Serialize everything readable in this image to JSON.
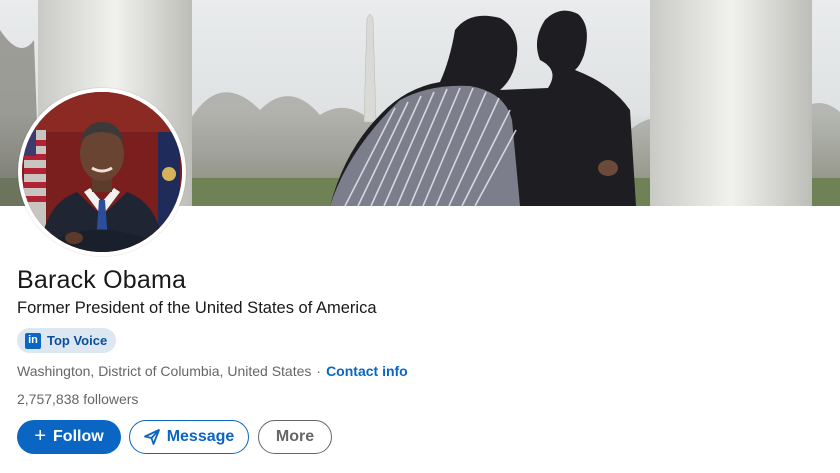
{
  "profile": {
    "name": "Barack Obama",
    "headline": "Former President of the United States of America",
    "badge": {
      "icon": "linkedin-logo-icon",
      "label": "Top Voice"
    },
    "location": "Washington, District of Columbia, United States",
    "separator": "·",
    "contact_link": "Contact info",
    "followers_count": "2,757,838",
    "followers_label": "followers"
  },
  "actions": {
    "follow_label": "Follow",
    "follow_icon": "plus-icon",
    "message_label": "Message",
    "message_icon": "paper-plane-icon",
    "more_label": "More"
  },
  "colors": {
    "accent": "#0a66c2",
    "badge_bg": "#dde7f1",
    "secondary_text": "#666666"
  }
}
